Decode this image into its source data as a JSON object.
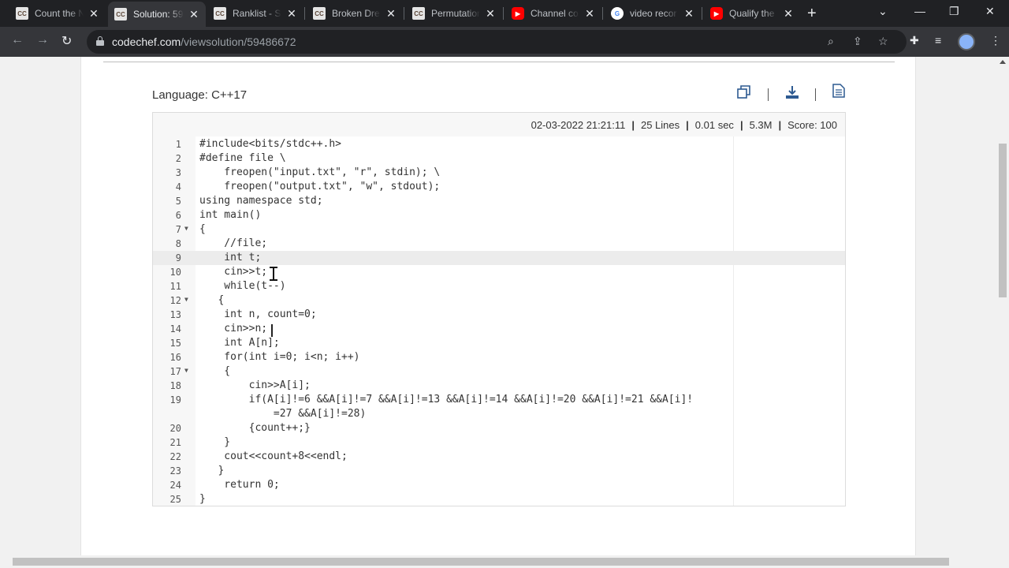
{
  "browser": {
    "tabs": [
      {
        "title": "Count the N",
        "favicon": "cc"
      },
      {
        "title": "Solution: 59",
        "favicon": "cc",
        "active": true
      },
      {
        "title": "Ranklist - S",
        "favicon": "cc"
      },
      {
        "title": "Broken Dre",
        "favicon": "cc"
      },
      {
        "title": "Permutation",
        "favicon": "cc"
      },
      {
        "title": "Channel co",
        "favicon": "yt"
      },
      {
        "title": "video recor",
        "favicon": "g"
      },
      {
        "title": "Qualify the",
        "favicon": "yt"
      }
    ],
    "url_host": "codechef.com",
    "url_path": "/viewsolution/59486672"
  },
  "solution": {
    "language_label": "Language: C++17",
    "meta": {
      "timestamp": "02-03-2022 21:21:11",
      "lines": "25 Lines",
      "time": "0.01 sec",
      "memory": "5.3M",
      "score": "Score: 100"
    },
    "code": [
      {
        "n": "1",
        "text": "#include<bits/stdc++.h>"
      },
      {
        "n": "2",
        "text": "#define file \\"
      },
      {
        "n": "3",
        "text": "    freopen(\"input.txt\", \"r\", stdin); \\"
      },
      {
        "n": "4",
        "text": "    freopen(\"output.txt\", \"w\", stdout);"
      },
      {
        "n": "5",
        "text": "using namespace std;"
      },
      {
        "n": "6",
        "text": "int main()"
      },
      {
        "n": "7",
        "text": "{",
        "fold": true
      },
      {
        "n": "8",
        "text": "    //file;"
      },
      {
        "n": "9",
        "text": "    int t;"
      },
      {
        "n": "10",
        "text": "    cin>>t;"
      },
      {
        "n": "11",
        "text": "    while(t--)"
      },
      {
        "n": "12",
        "text": "   {",
        "fold": true
      },
      {
        "n": "13",
        "text": "    int n, count=0;"
      },
      {
        "n": "14",
        "text": "    cin>>n;"
      },
      {
        "n": "15",
        "text": "    int A[n];"
      },
      {
        "n": "16",
        "text": "    for(int i=0; i<n; i++)"
      },
      {
        "n": "17",
        "text": "    {",
        "fold": true
      },
      {
        "n": "18",
        "text": "        cin>>A[i];"
      },
      {
        "n": "19",
        "text": "        if(A[i]!=6 &&A[i]!=7 &&A[i]!=13 &&A[i]!=14 &&A[i]!=20 &&A[i]!=21 &&A[i]!"
      },
      {
        "n": "",
        "text": "            =27 &&A[i]!=28)"
      },
      {
        "n": "20",
        "text": "        {count++;}"
      },
      {
        "n": "21",
        "text": "    }"
      },
      {
        "n": "22",
        "text": "    cout<<count+8<<endl;"
      },
      {
        "n": "23",
        "text": "   }"
      },
      {
        "n": "24",
        "text": "    return 0;"
      },
      {
        "n": "25",
        "text": "}"
      }
    ]
  }
}
